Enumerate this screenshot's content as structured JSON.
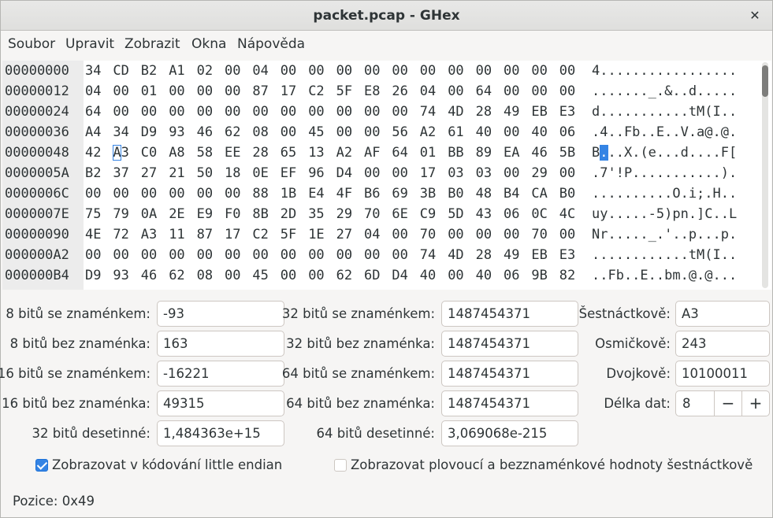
{
  "window": {
    "title": "packet.pcap - GHex",
    "close_glyph": "✕"
  },
  "menu": [
    "Soubor",
    "Upravit",
    "Zobrazit",
    "Okna",
    "Nápověda"
  ],
  "hex": {
    "offsets": [
      "00000000",
      "00000012",
      "00000024",
      "00000036",
      "00000048",
      "0000005A",
      "0000006C",
      "0000007E",
      "00000090",
      "000000A2",
      "000000B4"
    ],
    "rows": [
      [
        "34",
        "CD",
        "B2",
        "A1",
        "02",
        "00",
        "04",
        "00",
        "00",
        "00",
        "00",
        "00",
        "00",
        "00",
        "00",
        "00",
        "00",
        "00"
      ],
      [
        "04",
        "00",
        "01",
        "00",
        "00",
        "00",
        "87",
        "17",
        "C2",
        "5F",
        "E8",
        "26",
        "04",
        "00",
        "64",
        "00",
        "00",
        "00"
      ],
      [
        "64",
        "00",
        "00",
        "00",
        "00",
        "00",
        "00",
        "00",
        "00",
        "00",
        "00",
        "00",
        "74",
        "4D",
        "28",
        "49",
        "EB",
        "E3"
      ],
      [
        "A4",
        "34",
        "D9",
        "93",
        "46",
        "62",
        "08",
        "00",
        "45",
        "00",
        "00",
        "56",
        "A2",
        "61",
        "40",
        "00",
        "40",
        "06"
      ],
      [
        "42",
        "A3",
        "C0",
        "A8",
        "58",
        "EE",
        "28",
        "65",
        "13",
        "A2",
        "AF",
        "64",
        "01",
        "BB",
        "89",
        "EA",
        "46",
        "5B"
      ],
      [
        "B2",
        "37",
        "27",
        "21",
        "50",
        "18",
        "0E",
        "EF",
        "96",
        "D4",
        "00",
        "00",
        "17",
        "03",
        "03",
        "00",
        "29",
        "00"
      ],
      [
        "00",
        "00",
        "00",
        "00",
        "00",
        "00",
        "88",
        "1B",
        "E4",
        "4F",
        "B6",
        "69",
        "3B",
        "B0",
        "48",
        "B4",
        "CA",
        "B0"
      ],
      [
        "75",
        "79",
        "0A",
        "2E",
        "E9",
        "F0",
        "8B",
        "2D",
        "35",
        "29",
        "70",
        "6E",
        "C9",
        "5D",
        "43",
        "06",
        "0C",
        "4C"
      ],
      [
        "4E",
        "72",
        "A3",
        "11",
        "87",
        "17",
        "C2",
        "5F",
        "1E",
        "27",
        "04",
        "00",
        "70",
        "00",
        "00",
        "00",
        "70",
        "00"
      ],
      [
        "00",
        "00",
        "00",
        "00",
        "00",
        "00",
        "00",
        "00",
        "00",
        "00",
        "00",
        "00",
        "74",
        "4D",
        "28",
        "49",
        "EB",
        "E3"
      ],
      [
        "D9",
        "93",
        "46",
        "62",
        "08",
        "00",
        "45",
        "00",
        "00",
        "62",
        "6D",
        "D4",
        "40",
        "00",
        "40",
        "06",
        "9B",
        "82"
      ]
    ],
    "ascii": [
      "4.................",
      "......._.&..d.....",
      "d...........tM(I..",
      ".4..Fb..E..V.a@.@.",
      "B...X.(e...d....F[",
      ".7'!P...........).",
      "..........O.i;.H..",
      "uy.....-5)pn.]C..L",
      "Nr....._.'..p...p.",
      "............tM(I..",
      "..Fb..E..bm.@.@..."
    ],
    "cursor": {
      "row": 4,
      "col": 1
    }
  },
  "converter": {
    "s8": {
      "label": "8 bitů se znaménkem:",
      "value": "-93"
    },
    "u8": {
      "label": "8 bitů bez znaménka:",
      "value": "163"
    },
    "s16": {
      "label": "16 bitů se znaménkem:",
      "value": "-16221"
    },
    "u16": {
      "label": "16 bitů bez znaménka:",
      "value": "49315"
    },
    "f32": {
      "label": "32 bitů desetinné:",
      "value": "1,484363e+15"
    },
    "s32": {
      "label": "32 bitů se znaménkem:",
      "value": "1487454371"
    },
    "u32": {
      "label": "32 bitů bez znaménka:",
      "value": "1487454371"
    },
    "s64": {
      "label": "64 bitů se znaménkem:",
      "value": "1487454371"
    },
    "u64": {
      "label": "64 bitů bez znaménka:",
      "value": "1487454371"
    },
    "f64": {
      "label": "64 bitů desetinné:",
      "value": "3,069068e-215"
    },
    "hex": {
      "label": "Šestnáctkově:",
      "value": "A3"
    },
    "oct": {
      "label": "Osmičkově:",
      "value": "243"
    },
    "bin": {
      "label": "Dvojkově:",
      "value": "10100011"
    },
    "len": {
      "label": "Délka dat:",
      "value": "8",
      "minus": "−",
      "plus": "+"
    }
  },
  "options": {
    "little_endian": {
      "label": "Zobrazovat v kódování little endian",
      "checked": true
    },
    "unsigned_float_hex": {
      "label": "Zobrazovat plovoucí a bezznaménkové hodnoty šestnáctkově",
      "checked": false
    }
  },
  "status": {
    "position": "Pozice: 0x49"
  },
  "colors": {
    "accent": "#3584e4"
  }
}
